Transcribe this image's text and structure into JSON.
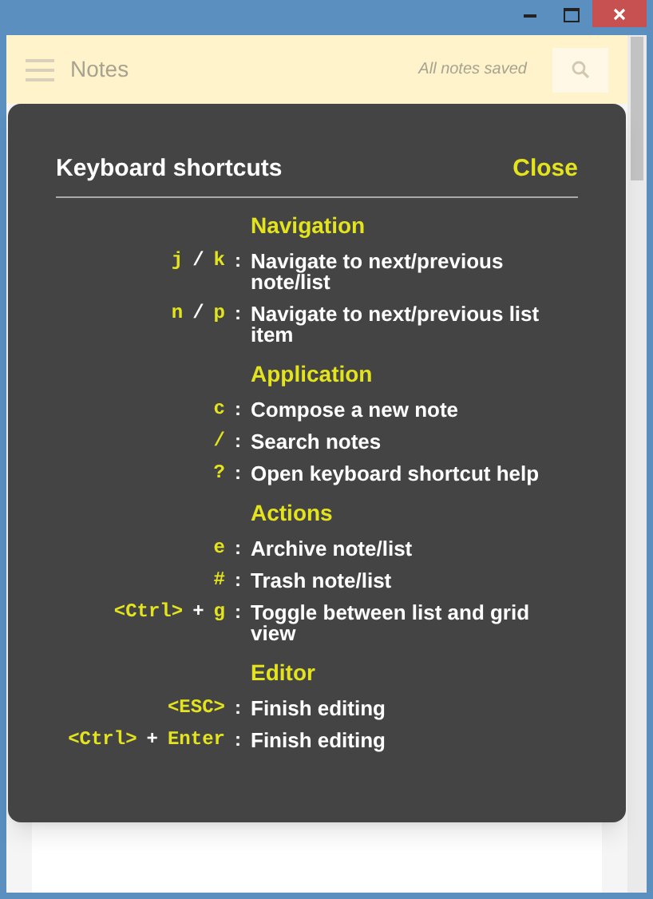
{
  "app_bar": {
    "title": "Notes",
    "status": "All notes saved"
  },
  "dialog": {
    "title": "Keyboard shortcuts",
    "close": "Close",
    "sections": [
      {
        "heading": "Navigation",
        "shortcuts": [
          {
            "keys": [
              {
                "text": "j",
                "kind": "key"
              },
              {
                "text": "/",
                "kind": "separator"
              },
              {
                "text": "k",
                "kind": "key"
              }
            ],
            "colon": ":",
            "description": "Navigate to next/previous note/list"
          },
          {
            "keys": [
              {
                "text": "n",
                "kind": "key"
              },
              {
                "text": "/",
                "kind": "separator"
              },
              {
                "text": "p",
                "kind": "key"
              }
            ],
            "colon": ":",
            "description": "Navigate to next/previous list item"
          }
        ]
      },
      {
        "heading": "Application",
        "shortcuts": [
          {
            "keys": [
              {
                "text": "c",
                "kind": "key"
              }
            ],
            "colon": ":",
            "description": "Compose a new note"
          },
          {
            "keys": [
              {
                "text": "/",
                "kind": "key"
              }
            ],
            "colon": ":",
            "description": "Search notes"
          },
          {
            "keys": [
              {
                "text": "?",
                "kind": "key"
              }
            ],
            "colon": ":",
            "description": "Open keyboard shortcut help"
          }
        ]
      },
      {
        "heading": "Actions",
        "shortcuts": [
          {
            "keys": [
              {
                "text": "e",
                "kind": "key"
              }
            ],
            "colon": ":",
            "description": "Archive note/list"
          },
          {
            "keys": [
              {
                "text": "#",
                "kind": "key"
              }
            ],
            "colon": ":",
            "description": "Trash note/list"
          },
          {
            "keys": [
              {
                "text": "<Ctrl>",
                "kind": "key"
              },
              {
                "text": "+",
                "kind": "separator"
              },
              {
                "text": "g",
                "kind": "key"
              }
            ],
            "colon": ":",
            "description": "Toggle between list and grid view"
          }
        ]
      },
      {
        "heading": "Editor",
        "shortcuts": [
          {
            "keys": [
              {
                "text": "<ESC>",
                "kind": "key"
              }
            ],
            "colon": ":",
            "description": "Finish editing"
          },
          {
            "keys": [
              {
                "text": "<Ctrl>",
                "kind": "key"
              },
              {
                "text": "+",
                "kind": "separator"
              },
              {
                "text": "Enter",
                "kind": "key"
              }
            ],
            "colon": ":",
            "description": "Finish editing"
          }
        ]
      }
    ]
  }
}
